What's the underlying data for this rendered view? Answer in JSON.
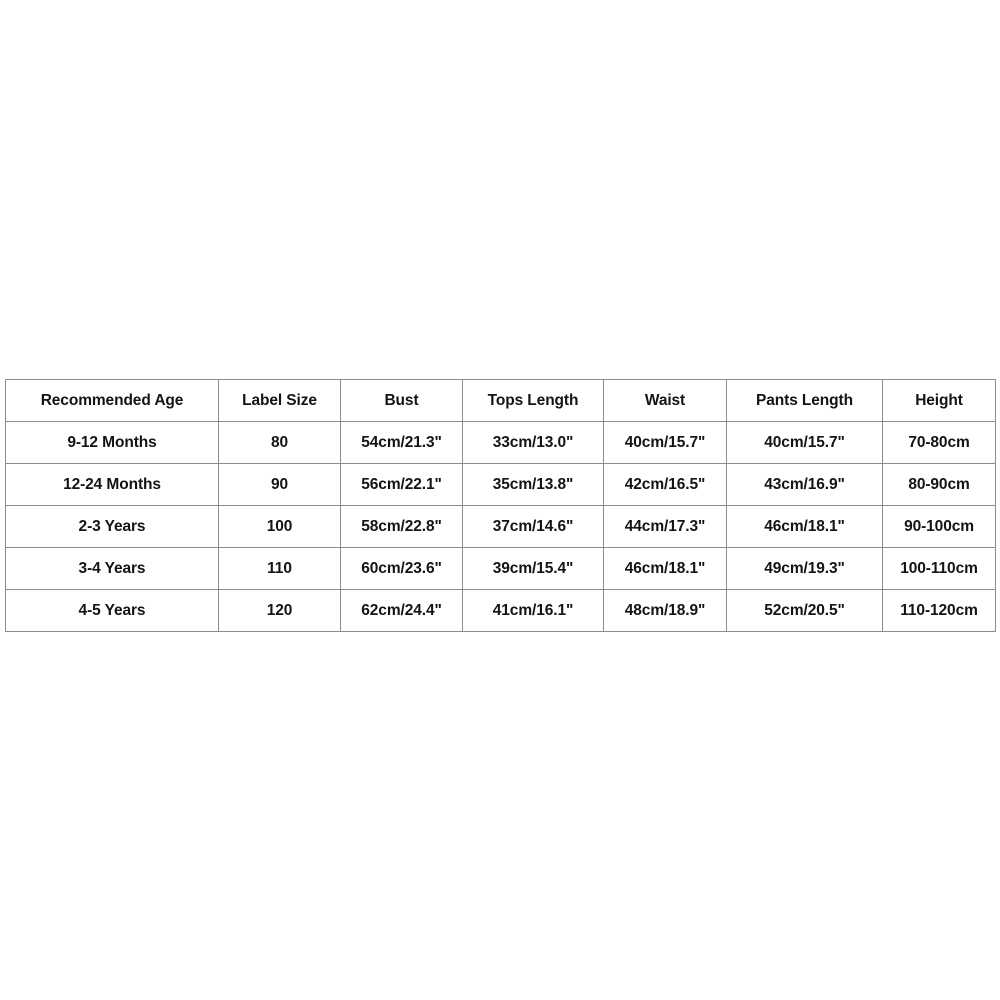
{
  "table": {
    "headers": [
      "Recommended Age",
      "Label Size",
      "Bust",
      "Tops Length",
      "Waist",
      "Pants Length",
      "Height"
    ],
    "rows": [
      {
        "recommended_age": "9-12 Months",
        "label_size": "80",
        "bust": "54cm/21.3\"",
        "tops_length": "33cm/13.0\"",
        "waist": "40cm/15.7\"",
        "pants_length": "40cm/15.7\"",
        "height": "70-80cm"
      },
      {
        "recommended_age": "12-24 Months",
        "label_size": "90",
        "bust": "56cm/22.1\"",
        "tops_length": "35cm/13.8\"",
        "waist": "42cm/16.5\"",
        "pants_length": "43cm/16.9\"",
        "height": "80-90cm"
      },
      {
        "recommended_age": "2-3 Years",
        "label_size": "100",
        "bust": "58cm/22.8\"",
        "tops_length": "37cm/14.6\"",
        "waist": "44cm/17.3\"",
        "pants_length": "46cm/18.1\"",
        "height": "90-100cm"
      },
      {
        "recommended_age": "3-4 Years",
        "label_size": "110",
        "bust": "60cm/23.6\"",
        "tops_length": "39cm/15.4\"",
        "waist": "46cm/18.1\"",
        "pants_length": "49cm/19.3\"",
        "height": "100-110cm"
      },
      {
        "recommended_age": "4-5 Years",
        "label_size": "120",
        "bust": "62cm/24.4\"",
        "tops_length": "41cm/16.1\"",
        "waist": "48cm/18.9\"",
        "pants_length": "52cm/20.5\"",
        "height": "110-120cm"
      }
    ]
  },
  "colors": {
    "background": "#ffffff",
    "border": "#8c8c8c",
    "text": "#141414"
  }
}
